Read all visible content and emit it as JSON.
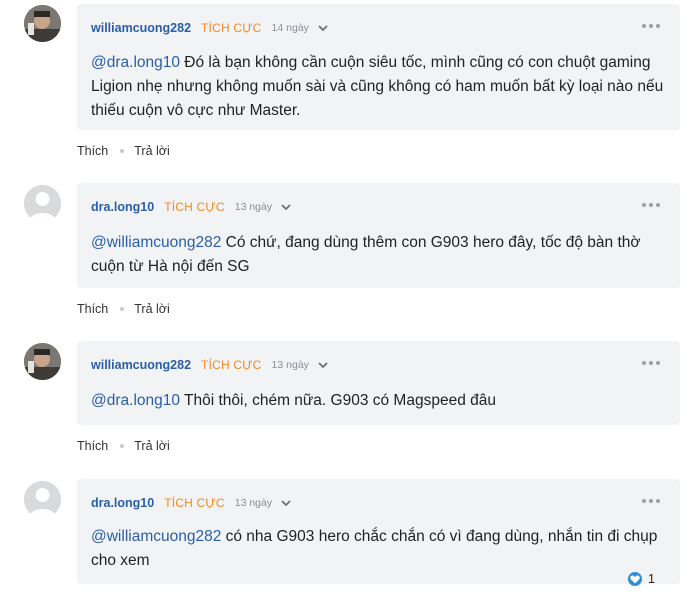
{
  "comments": [
    {
      "username": "williamcuong282",
      "badge": "TÍCH CỰC",
      "time": "14 ngày",
      "mention": "@dra.long10",
      "text": " Đó là bạn không cần cuộn siêu tốc, mình cũng có con chuột gaming Ligion nhẹ nhưng không muốn sài và cũng không có ham muốn bất kỳ loại nào nếu thiếu cuộn vô cực như Master.",
      "avatar": "photo",
      "like_label": "Thích",
      "reply_label": "Trả lời"
    },
    {
      "username": "dra.long10",
      "badge": "TÍCH CỰC",
      "time": "13 ngày",
      "mention": "@williamcuong282",
      "text": " Có chứ, đang dùng thêm con G903 hero đây, tốc độ bàn thờ cuộn từ Hà nội đến SG",
      "avatar": "blank",
      "like_label": "Thích",
      "reply_label": "Trả lời"
    },
    {
      "username": "williamcuong282",
      "badge": "TÍCH CỰC",
      "time": "13 ngày",
      "mention": "@dra.long10",
      "text": " Thôi thôi, chém nữa. G903 có Magspeed đâu",
      "avatar": "photo",
      "like_label": "Thích",
      "reply_label": "Trả lời"
    },
    {
      "username": "dra.long10",
      "badge": "TÍCH CỰC",
      "time": "13 ngày",
      "mention": "@williamcuong282",
      "text": " có nha G903 hero chắc chắn có vì đang dùng, nhắn tin đi chụp cho xem",
      "avatar": "blank",
      "reaction_count": "1"
    }
  ],
  "colors": {
    "username": "#2a5ea8",
    "badge": "#f08a24",
    "bubble": "#f2f3f5",
    "reaction": "#2f8fd3"
  },
  "icons": {
    "menu": "chevron-down-icon",
    "more": "more-dots-icon",
    "reaction": "heart-reaction-icon"
  }
}
